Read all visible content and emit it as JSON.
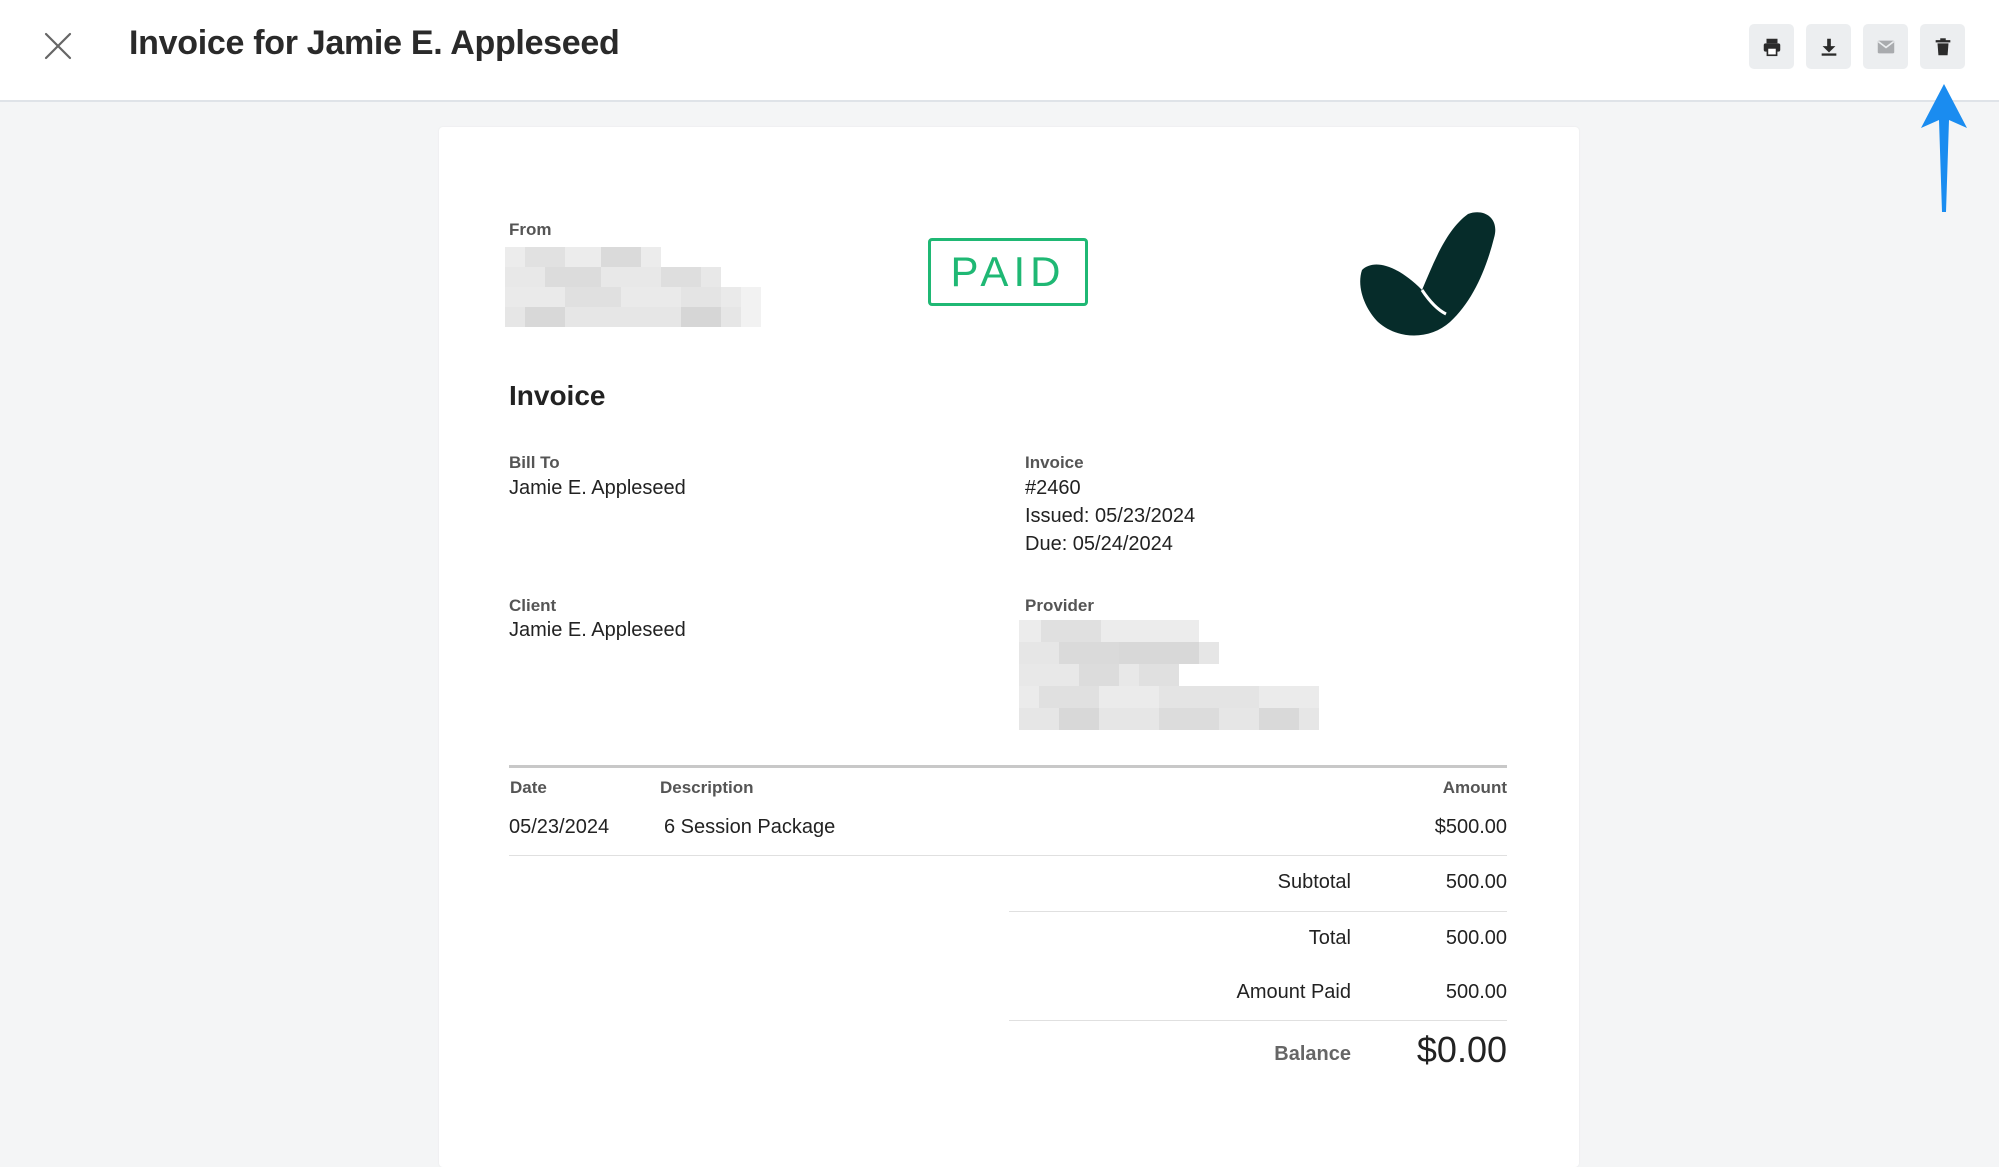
{
  "header": {
    "title": "Invoice for Jamie E. Appleseed",
    "close_icon": "close-icon",
    "toolbar": [
      {
        "name": "print",
        "icon": "printer-icon"
      },
      {
        "name": "download",
        "icon": "download-icon"
      },
      {
        "name": "email",
        "icon": "mail-icon"
      },
      {
        "name": "delete",
        "icon": "trash-icon"
      }
    ]
  },
  "invoice": {
    "from_label": "From",
    "stamp": "PAID",
    "heading": "Invoice",
    "bill_to_label": "Bill To",
    "bill_to_name": "Jamie E. Appleseed",
    "invoice_label": "Invoice",
    "number": "#2460",
    "issued": "Issued: 05/23/2024",
    "due": "Due: 05/24/2024",
    "client_label": "Client",
    "client_name": "Jamie E. Appleseed",
    "provider_label": "Provider",
    "table": {
      "headers": {
        "date": "Date",
        "description": "Description",
        "amount": "Amount"
      },
      "rows": [
        {
          "date": "05/23/2024",
          "description": "6 Session Package",
          "amount": "$500.00"
        }
      ]
    },
    "totals": {
      "subtotal_label": "Subtotal",
      "subtotal": "500.00",
      "total_label": "Total",
      "total": "500.00",
      "paid_label": "Amount Paid",
      "paid": "500.00",
      "balance_label": "Balance",
      "balance": "$0.00"
    }
  },
  "colors": {
    "accent": "#1fb874",
    "logo": "#062c2a",
    "arrow": "#1a8cf0"
  }
}
